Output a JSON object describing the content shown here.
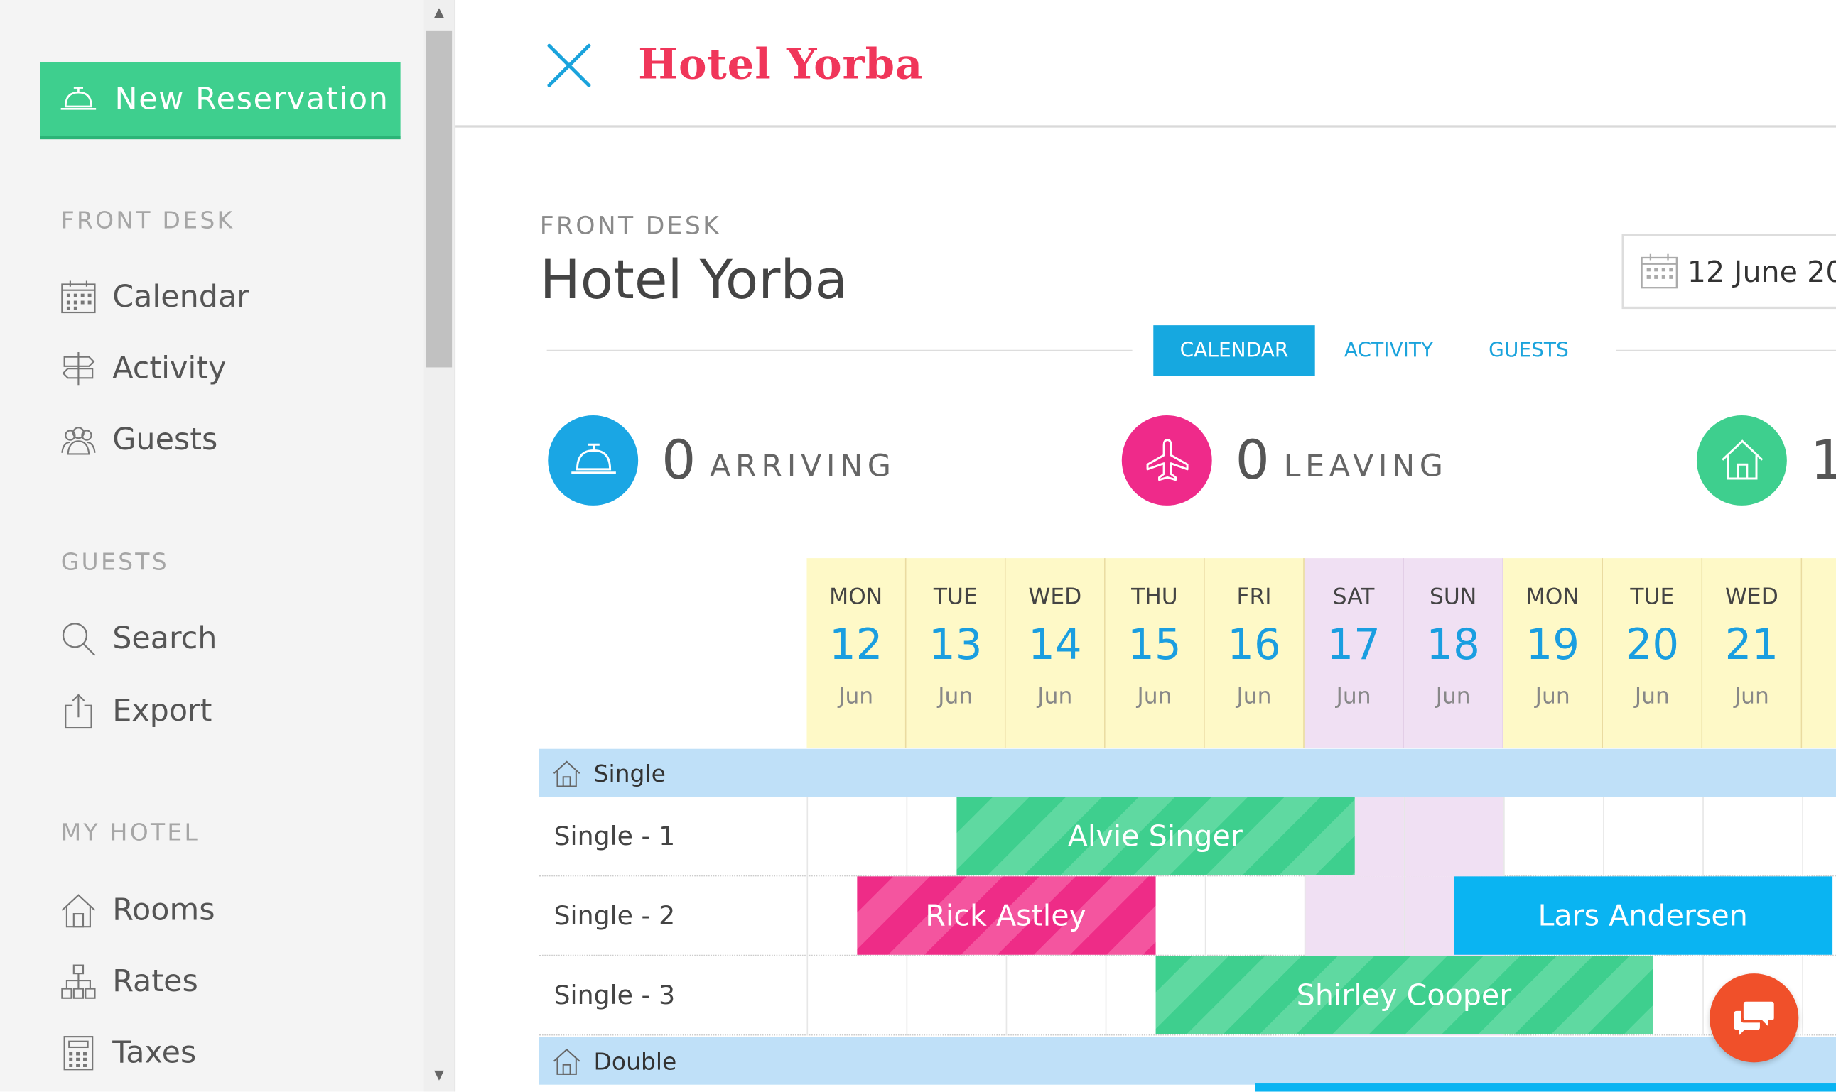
{
  "sidebar": {
    "new_reservation": "New Reservation",
    "sections": [
      {
        "heading": "FRONT DESK",
        "items": [
          {
            "label": "Calendar",
            "icon": "calendar-icon"
          },
          {
            "label": "Activity",
            "icon": "signpost-icon"
          },
          {
            "label": "Guests",
            "icon": "guests-icon"
          }
        ]
      },
      {
        "heading": "GUESTS",
        "items": [
          {
            "label": "Search",
            "icon": "search-icon"
          },
          {
            "label": "Export",
            "icon": "export-icon"
          }
        ]
      },
      {
        "heading": "MY HOTEL",
        "items": [
          {
            "label": "Rooms",
            "icon": "house-icon"
          },
          {
            "label": "Rates",
            "icon": "rates-icon"
          },
          {
            "label": "Taxes",
            "icon": "calculator-icon"
          }
        ]
      }
    ]
  },
  "topbar": {
    "brand": "Hotel Yorba"
  },
  "header": {
    "breadcrumb": "FRONT DESK",
    "title": "Hotel Yorba",
    "date": "12 June 20"
  },
  "tabs": [
    {
      "label": "CALENDAR",
      "active": true
    },
    {
      "label": "ACTIVITY",
      "active": false
    },
    {
      "label": "GUESTS",
      "active": false
    }
  ],
  "stats": [
    {
      "count": "0",
      "label": "ARRIVING",
      "color": "#1aa6e4",
      "icon": "bell-icon"
    },
    {
      "count": "0",
      "label": "LEAVING",
      "color": "#ef2a8a",
      "icon": "plane-icon"
    },
    {
      "count": "1",
      "label": "",
      "color": "#3ecf8e",
      "icon": "house-icon"
    }
  ],
  "days": [
    {
      "dow": "MON",
      "num": "12",
      "mon": "Jun",
      "weekend": false
    },
    {
      "dow": "TUE",
      "num": "13",
      "mon": "Jun",
      "weekend": false
    },
    {
      "dow": "WED",
      "num": "14",
      "mon": "Jun",
      "weekend": false
    },
    {
      "dow": "THU",
      "num": "15",
      "mon": "Jun",
      "weekend": false
    },
    {
      "dow": "FRI",
      "num": "16",
      "mon": "Jun",
      "weekend": false
    },
    {
      "dow": "SAT",
      "num": "17",
      "mon": "Jun",
      "weekend": true
    },
    {
      "dow": "SUN",
      "num": "18",
      "mon": "Jun",
      "weekend": true
    },
    {
      "dow": "MON",
      "num": "19",
      "mon": "Jun",
      "weekend": false
    },
    {
      "dow": "TUE",
      "num": "20",
      "mon": "Jun",
      "weekend": false
    },
    {
      "dow": "WED",
      "num": "21",
      "mon": "Jun",
      "weekend": false
    },
    {
      "dow": "T",
      "num": "2",
      "mon": "",
      "weekend": false
    }
  ],
  "categories": [
    "Single",
    "Double"
  ],
  "rooms": [
    "Single - 1",
    "Single - 2",
    "Single - 3"
  ],
  "bookings": [
    {
      "guest": "Alvie Singer",
      "room": 0,
      "start_day": 1.5,
      "end_day": 5.5,
      "color": "green"
    },
    {
      "guest": "Rick Astley",
      "room": 1,
      "start_day": 0.5,
      "end_day": 3.5,
      "color": "pink"
    },
    {
      "guest": "Lars Andersen",
      "room": 1,
      "start_day": 6.5,
      "end_day": 10.3,
      "color": "blue"
    },
    {
      "guest": "Shirley Cooper",
      "room": 2,
      "start_day": 3.5,
      "end_day": 8.5,
      "color": "green"
    }
  ]
}
